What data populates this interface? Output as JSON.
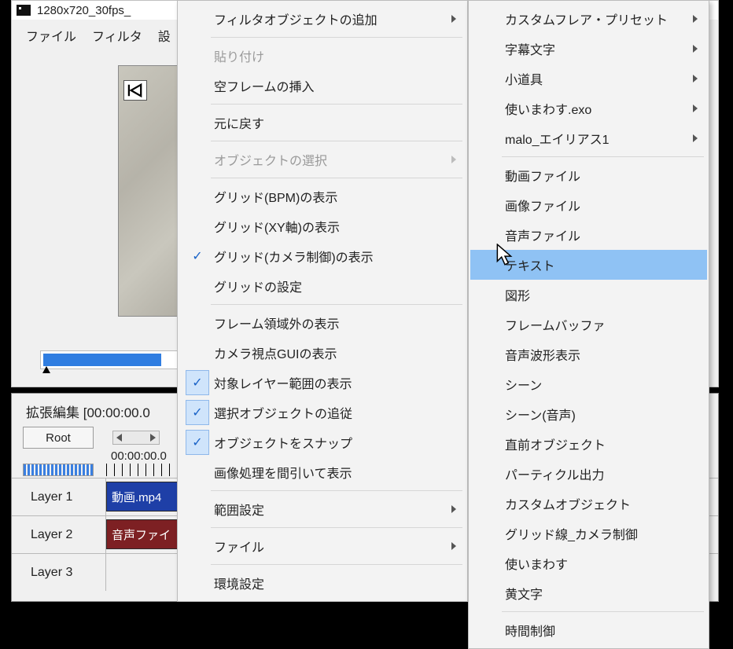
{
  "app": {
    "title": "1280x720_30fps_",
    "menubar": [
      "ファイル",
      "フィルタ",
      "設"
    ]
  },
  "seek": {
    "playhead": "|"
  },
  "timeline": {
    "title": "拡張編集 [00:00:00.0",
    "root_label": "Root",
    "timecode": "00:00:00.0",
    "layers": [
      {
        "label": "Layer 1",
        "clip": "動画.mp4",
        "clip_kind": "video"
      },
      {
        "label": "Layer 2",
        "clip": "音声ファイ",
        "clip_kind": "audio"
      },
      {
        "label": "Layer 3"
      }
    ]
  },
  "ctx_menu": {
    "items": [
      {
        "label": "フィルタオブジェクトの追加",
        "submenu": true
      },
      {
        "sep": true
      },
      {
        "label": "貼り付け",
        "disabled": true
      },
      {
        "label": "空フレームの挿入"
      },
      {
        "sep": true
      },
      {
        "label": "元に戻す"
      },
      {
        "sep": true
      },
      {
        "label": "オブジェクトの選択",
        "submenu": true,
        "disabled": true
      },
      {
        "sep": true
      },
      {
        "label": "グリッド(BPM)の表示"
      },
      {
        "label": "グリッド(XY軸)の表示"
      },
      {
        "label": "グリッド(カメラ制御)の表示",
        "checked": true
      },
      {
        "label": "グリッドの設定"
      },
      {
        "sep": true
      },
      {
        "label": "フレーム領域外の表示"
      },
      {
        "label": "カメラ視点GUIの表示"
      },
      {
        "label": "対象レイヤー範囲の表示",
        "checked": true,
        "check_bg": true
      },
      {
        "label": "選択オブジェクトの追従",
        "checked": true,
        "check_bg": true
      },
      {
        "label": "オブジェクトをスナップ",
        "checked": true,
        "check_bg": true
      },
      {
        "label": "画像処理を間引いて表示"
      },
      {
        "sep": true
      },
      {
        "label": "範囲設定",
        "submenu": true
      },
      {
        "sep": true
      },
      {
        "label": "ファイル",
        "submenu": true
      },
      {
        "sep": true
      },
      {
        "label": "環境設定"
      }
    ]
  },
  "sub_menu": {
    "items": [
      {
        "label": "カスタムフレア・プリセット",
        "submenu": true
      },
      {
        "label": "字幕文字",
        "submenu": true
      },
      {
        "label": "小道具",
        "submenu": true
      },
      {
        "label": "使いまわす.exo",
        "submenu": true
      },
      {
        "label": "malo_エイリアス1",
        "submenu": true
      },
      {
        "sep": true
      },
      {
        "label": "動画ファイル"
      },
      {
        "label": "画像ファイル"
      },
      {
        "label": "音声ファイル"
      },
      {
        "label": "テキスト",
        "hover": true
      },
      {
        "label": "図形"
      },
      {
        "label": "フレームバッファ"
      },
      {
        "label": "音声波形表示"
      },
      {
        "label": "シーン"
      },
      {
        "label": "シーン(音声)"
      },
      {
        "label": "直前オブジェクト"
      },
      {
        "label": "パーティクル出力"
      },
      {
        "label": "カスタムオブジェクト"
      },
      {
        "label": "グリッド線_カメラ制御"
      },
      {
        "label": "使いまわす"
      },
      {
        "label": "黄文字"
      },
      {
        "sep": true
      },
      {
        "label": "時間制御"
      }
    ]
  }
}
